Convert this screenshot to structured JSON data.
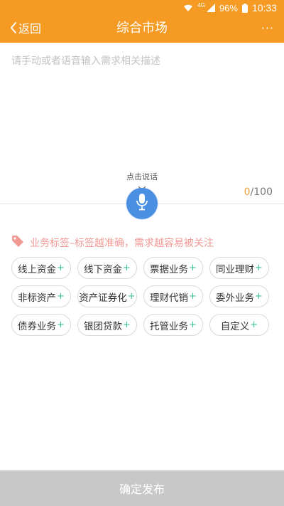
{
  "status_bar": {
    "network": "4G",
    "battery": "96%",
    "time": "10:33"
  },
  "header": {
    "back_label": "返回",
    "title": "综合市场",
    "more": "···"
  },
  "description": {
    "placeholder": "请手动或者语音输入需求相关描述",
    "value": ""
  },
  "voice": {
    "hint": "点击说话",
    "counter_used": "0",
    "counter_total": "/100"
  },
  "tag_section": {
    "hint": "业务标签–标签越准确，需求越容易被关注",
    "tags": [
      {
        "label": "线上资金",
        "plus": "+"
      },
      {
        "label": "线下资金",
        "plus": "+"
      },
      {
        "label": "票据业务",
        "plus": "+"
      },
      {
        "label": "同业理财",
        "plus": "+"
      },
      {
        "label": "非标资产",
        "plus": "+"
      },
      {
        "label": "资产证券化",
        "plus": "+"
      },
      {
        "label": "理财代销",
        "plus": "+"
      },
      {
        "label": "委外业务",
        "plus": "+"
      },
      {
        "label": "债券业务",
        "plus": "+"
      },
      {
        "label": "银团贷款",
        "plus": "+"
      },
      {
        "label": "托管业务",
        "plus": "+"
      },
      {
        "label": "自定义",
        "plus": "+"
      }
    ]
  },
  "footer": {
    "submit_label": "确定发布"
  },
  "colors": {
    "accent": "#f59a23",
    "mic": "#4a90e2",
    "tag_plus": "#3cbfa0",
    "tag_hint": "#f19a95",
    "submit_bg": "#c8c8c8"
  }
}
